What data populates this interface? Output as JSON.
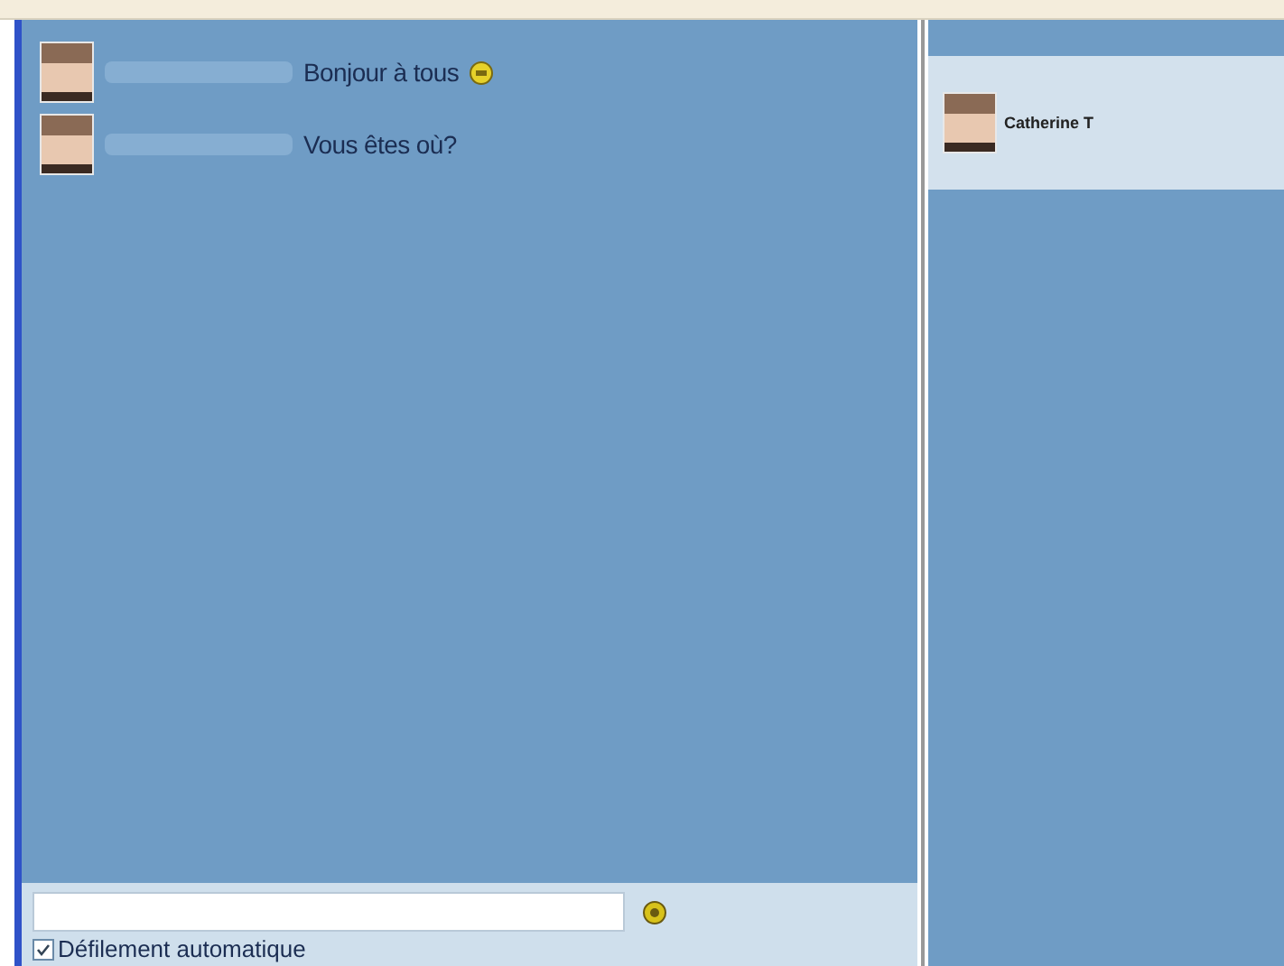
{
  "messages": [
    {
      "text": "Bonjour à tous",
      "smiley": true
    },
    {
      "text": "Vous êtes où?",
      "smiley": false
    }
  ],
  "composer": {
    "auto_scroll": {
      "label": "Défilement automatique",
      "checked": true
    }
  },
  "users": [
    {
      "name": "Catherine T"
    }
  ]
}
